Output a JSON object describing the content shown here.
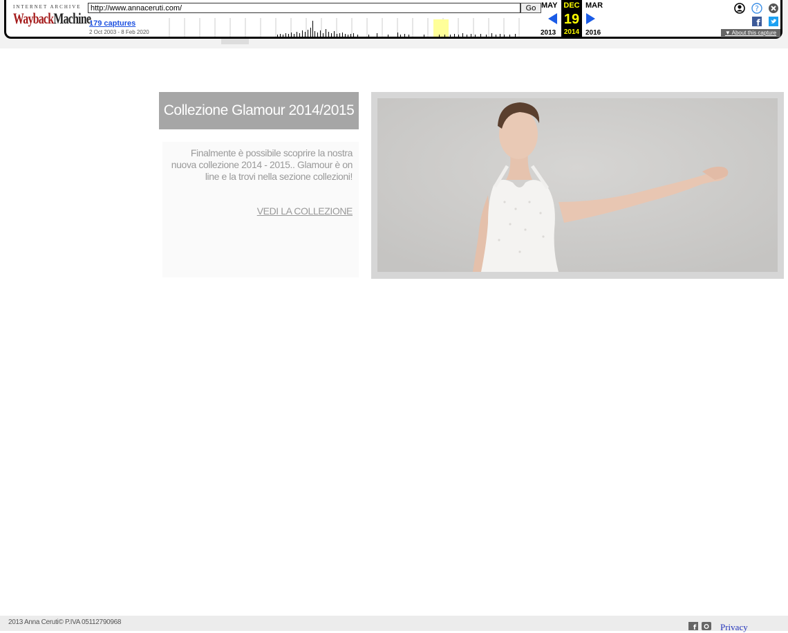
{
  "wayback": {
    "logo_top": "INTERNET ARCHIVE",
    "logo_wayback": "Wayback",
    "logo_machine": "Machine",
    "url": "http://www.annaceruti.com/",
    "go_label": "Go",
    "captures": "179 captures",
    "range": "2 Oct 2003 - 8 Feb 2020",
    "prev_month": "MAY",
    "cur_month": "DEC",
    "next_month": "MAR",
    "day": "19",
    "prev_year": "2013",
    "cur_year": "2014",
    "next_year": "2016",
    "about": "About this capture"
  },
  "content": {
    "collection_title": "Collezione Glamour 2014/2015",
    "collection_text": "Finalmente è possibile scoprire la nostra nuova collezione 2014 - 2015.. Glamour è on line e la trovi nella sezione collezioni!",
    "collection_link": "VEDI LA COLLEZIONE"
  },
  "footer": {
    "copyright": "2013 Anna Ceruti© P.IVA 05112790968",
    "privacy": "Privacy"
  }
}
